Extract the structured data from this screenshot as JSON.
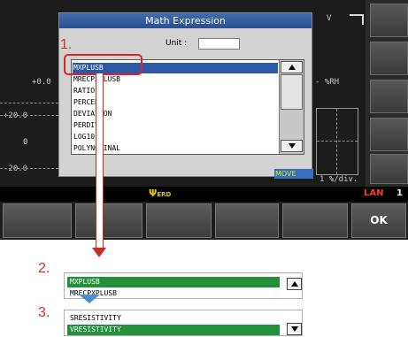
{
  "instrument": {
    "bg_top_left": "+0.0",
    "bg_top_right": "V",
    "bg_unit_right": "- %RH",
    "bg_axis_labels": [
      "+20.0",
      "0",
      "-20.0"
    ],
    "bg_div_label": "1 %/div.",
    "status": {
      "usb_icon": "usb-icon",
      "usb_subtext": "ERD",
      "lan": "LAN",
      "lan_channel": "1"
    },
    "softkeys": [
      "",
      "",
      "",
      "",
      "",
      "OK"
    ]
  },
  "dialog": {
    "title": "Math Expression",
    "unit_label": "Unit :",
    "unit_value": "",
    "items": [
      "MXPLUSB",
      "MRECPXPLUSB",
      "RATIO",
      "PERCENT",
      "DEVIATION",
      "PERDIV",
      "LOG10",
      "POLYNOMINAL"
    ],
    "selected_index": 0,
    "move_label": "MOVE"
  },
  "callouts": {
    "step1": "1.",
    "step2": "2.",
    "step3": "3."
  },
  "crops": {
    "step2": {
      "top": "MXPLUSB",
      "bottom": "MRECPXPLUSB"
    },
    "step3": {
      "top": "SRESISTIVITY",
      "bottom": "VRESISTIVITY"
    }
  },
  "colors": {
    "bezel": "#f2d33e",
    "dialog_title": "#2a4f8e",
    "selection": "#2b59a8",
    "green_selection": "#22913a",
    "callout_red": "#d8301e",
    "lan_red": "#ff3a2c",
    "move_yellow": "#e6e600"
  }
}
